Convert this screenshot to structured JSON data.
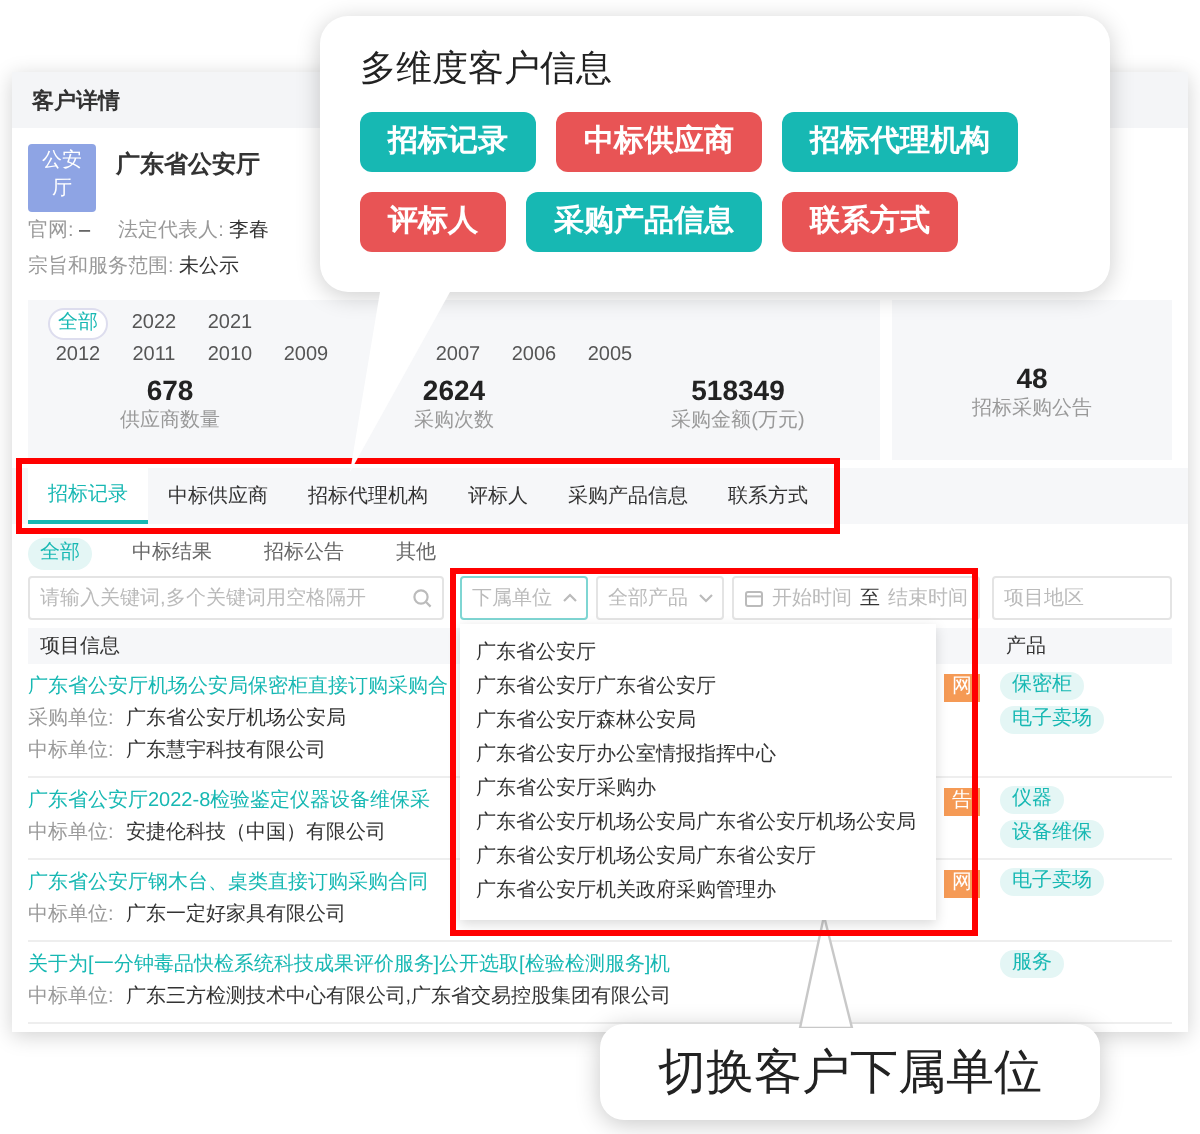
{
  "window": {
    "title": "客户详情"
  },
  "customer": {
    "avatar": "公安厅",
    "name": "广东省公安厅",
    "info_lines": [
      [
        {
          "label": "官网:",
          "value": "–"
        },
        {
          "label": "法定代表人:",
          "value": "李春"
        }
      ],
      [
        {
          "label": "宗旨和服务范围:",
          "value": "未公示"
        }
      ]
    ]
  },
  "years": [
    [
      {
        "label": "全部",
        "selected": true
      },
      {
        "label": "2022",
        "selected": false
      },
      {
        "label": "2021",
        "selected": false
      }
    ],
    [
      {
        "label": "2012",
        "selected": false
      },
      {
        "label": "2011",
        "selected": false
      },
      {
        "label": "2010",
        "selected": false
      },
      {
        "label": "2009",
        "selected": false
      },
      {
        "label": "2007",
        "selected": false
      },
      {
        "label": "2006",
        "selected": false
      },
      {
        "label": "2005",
        "selected": false
      }
    ]
  ],
  "stats": [
    {
      "value": "678",
      "label": "供应商数量"
    },
    {
      "value": "2624",
      "label": "采购次数"
    },
    {
      "value": "518349",
      "label": "采购金额(万元)"
    },
    {
      "value": "48",
      "label": "招标采购公告"
    }
  ],
  "tabs": [
    {
      "label": "招标记录",
      "selected": true
    },
    {
      "label": "中标供应商",
      "selected": false
    },
    {
      "label": "招标代理机构",
      "selected": false
    },
    {
      "label": "评标人",
      "selected": false
    },
    {
      "label": "采购产品信息",
      "selected": false
    },
    {
      "label": "联系方式",
      "selected": false
    }
  ],
  "subtabs": [
    {
      "label": "全部",
      "selected": true
    },
    {
      "label": "中标结果",
      "selected": false
    },
    {
      "label": "招标公告",
      "selected": false
    },
    {
      "label": "其他",
      "selected": false
    }
  ],
  "filters": {
    "search": {
      "placeholder": "请输入关键词,多个关键词用空格隔开"
    },
    "unit_select": {
      "placeholder": "下属单位",
      "expanded": true
    },
    "product_select": {
      "placeholder": "全部产品"
    },
    "start_date": {
      "placeholder": "开始时间"
    },
    "range_separator": "至",
    "end_date": {
      "placeholder": "结束时间"
    },
    "region": {
      "placeholder": "项目地区"
    }
  },
  "unit_options": [
    "广东省公安厅",
    "广东省公安厅广东省公安厅",
    "广东省公安厅森林公安局",
    "广东省公安厅办公室情报指挥中心",
    "广东省公安厅采购办",
    "广东省公安厅机场公安局广东省公安厅机场公安局",
    "广东省公安厅机场公安局广东省公安厅",
    "广东省公安厅机关政府采购管理办"
  ],
  "table": {
    "columns": [
      "项目信息",
      "产品"
    ],
    "rows": [
      {
        "title": "广东省公安厅机场公安局保密柜直接订购采购合",
        "fields": [
          {
            "label": "采购单位:",
            "value": "广东省公安厅机场公安局"
          },
          {
            "label": "中标单位:",
            "value": "广东慧宇科技有限公司"
          }
        ],
        "badge": "网",
        "products": [
          "保密柜",
          "电子卖场"
        ]
      },
      {
        "title": "广东省公安厅2022-8检验鉴定仪器设备维保采",
        "fields": [
          {
            "label": "中标单位:",
            "value": "安捷伦科技（中国）有限公司"
          }
        ],
        "badge": "告",
        "products": [
          "仪器",
          "设备维保"
        ]
      },
      {
        "title": "广东省公安厅钢木台、桌类直接订购采购合同",
        "fields": [
          {
            "label": "中标单位:",
            "value": "广东一定好家具有限公司"
          }
        ],
        "badge": "网",
        "products": [
          "电子卖场"
        ]
      },
      {
        "title": "关于为[一分钟毒品快检系统科技成果评价服务]公开选取[检验检测服务]机",
        "fields": [
          {
            "label": "中标单位:",
            "value": "广东三方检测技术中心有限公司,广东省交易控股集团有限公司"
          }
        ],
        "products": [
          "服务"
        ]
      }
    ]
  },
  "feature_callout": {
    "title": "多维度客户信息",
    "tags": [
      {
        "label": "招标记录",
        "color": "#17b8b3"
      },
      {
        "label": "中标供应商",
        "color": "#e85455"
      },
      {
        "label": "招标代理机构",
        "color": "#17b8b3"
      },
      {
        "label": "评标人",
        "color": "#e85455"
      },
      {
        "label": "采购产品信息",
        "color": "#17b8b3"
      },
      {
        "label": "联系方式",
        "color": "#e85455"
      }
    ]
  },
  "unit_callout": {
    "text": "切换客户下属单位"
  }
}
